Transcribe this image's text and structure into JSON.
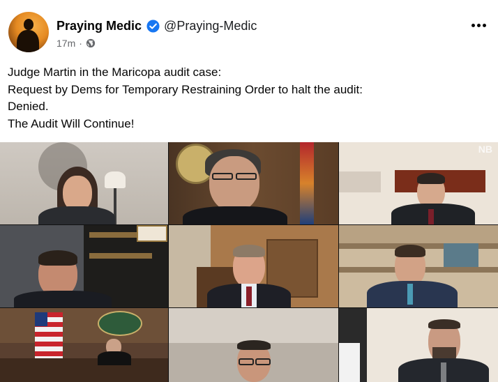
{
  "post": {
    "author_name": "Praying Medic",
    "author_handle": "@Praying-Medic",
    "timestamp": "17m",
    "meta_separator": "·",
    "text_lines": [
      "Judge Martin in the Maricopa audit case:",
      "Request by Dems for Temporary Restraining Order to halt the audit:",
      "Denied.",
      "The Audit Will Continue!"
    ],
    "verified_color": "#1877f2"
  },
  "video": {
    "watermark": "NB"
  }
}
